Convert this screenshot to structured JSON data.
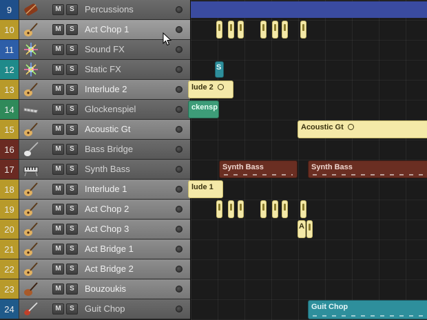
{
  "tracks": [
    {
      "num": "9",
      "name": "Percussions",
      "color": "#1f4f8a",
      "icon": "percussion-icon",
      "shade": "dark"
    },
    {
      "num": "10",
      "name": "Act Chop 1",
      "color": "#b89a2a",
      "icon": "acoustic-guitar-icon",
      "shade": "sel"
    },
    {
      "num": "11",
      "name": "Sound FX",
      "color": "#2d5ea8",
      "icon": "sparkle-icon",
      "shade": "dark"
    },
    {
      "num": "12",
      "name": "Static FX",
      "color": "#1f8a8a",
      "icon": "sparkle-icon",
      "shade": "dark"
    },
    {
      "num": "13",
      "name": "Interlude 2",
      "color": "#b89a2a",
      "icon": "acoustic-guitar-icon",
      "shade": "light"
    },
    {
      "num": "14",
      "name": "Glockenspiel",
      "color": "#2f8a5a",
      "icon": "glockenspiel-icon",
      "shade": "dark"
    },
    {
      "num": "15",
      "name": "Acoustic Gt",
      "color": "#b89a2a",
      "icon": "acoustic-guitar-icon",
      "shade": "light"
    },
    {
      "num": "16",
      "name": "Bass Bridge",
      "color": "#6a2a22",
      "icon": "bass-guitar-icon",
      "shade": "dark"
    },
    {
      "num": "17",
      "name": "Synth Bass",
      "color": "#6a2a22",
      "icon": "keyboard-icon",
      "shade": "dark"
    },
    {
      "num": "18",
      "name": "Interlude 1",
      "color": "#b89a2a",
      "icon": "acoustic-guitar-icon",
      "shade": "light"
    },
    {
      "num": "19",
      "name": "Act Chop 2",
      "color": "#b89a2a",
      "icon": "acoustic-guitar-icon",
      "shade": "light"
    },
    {
      "num": "20",
      "name": "Act Chop 3",
      "color": "#b89a2a",
      "icon": "acoustic-guitar-icon",
      "shade": "light"
    },
    {
      "num": "21",
      "name": "Act Bridge 1",
      "color": "#b89a2a",
      "icon": "acoustic-guitar-icon",
      "shade": "light"
    },
    {
      "num": "22",
      "name": "Act Bridge 2",
      "color": "#b89a2a",
      "icon": "acoustic-guitar-icon",
      "shade": "light"
    },
    {
      "num": "23",
      "name": "Bouzoukis",
      "color": "#b89a2a",
      "icon": "bouzouki-icon",
      "shade": "light"
    },
    {
      "num": "24",
      "name": "Guit Chop",
      "color": "#1f5a8a",
      "icon": "electric-guitar-icon",
      "shade": "dark"
    }
  ],
  "buttons": {
    "mute_label": "M",
    "solo_label": "S"
  },
  "regions": {
    "static_fx": "S",
    "interlude_2": "lude 2",
    "glockenspiel": "ckensp",
    "acoustic_gt": "Acoustic Gt",
    "synth_bass_1": "Synth Bass",
    "synth_bass_2": "Synth Bass",
    "interlude_1": "lude 1",
    "act_chop_2_mark": "A",
    "act_chop_3_mark": "A",
    "guit_chop": "Guit Chop"
  }
}
